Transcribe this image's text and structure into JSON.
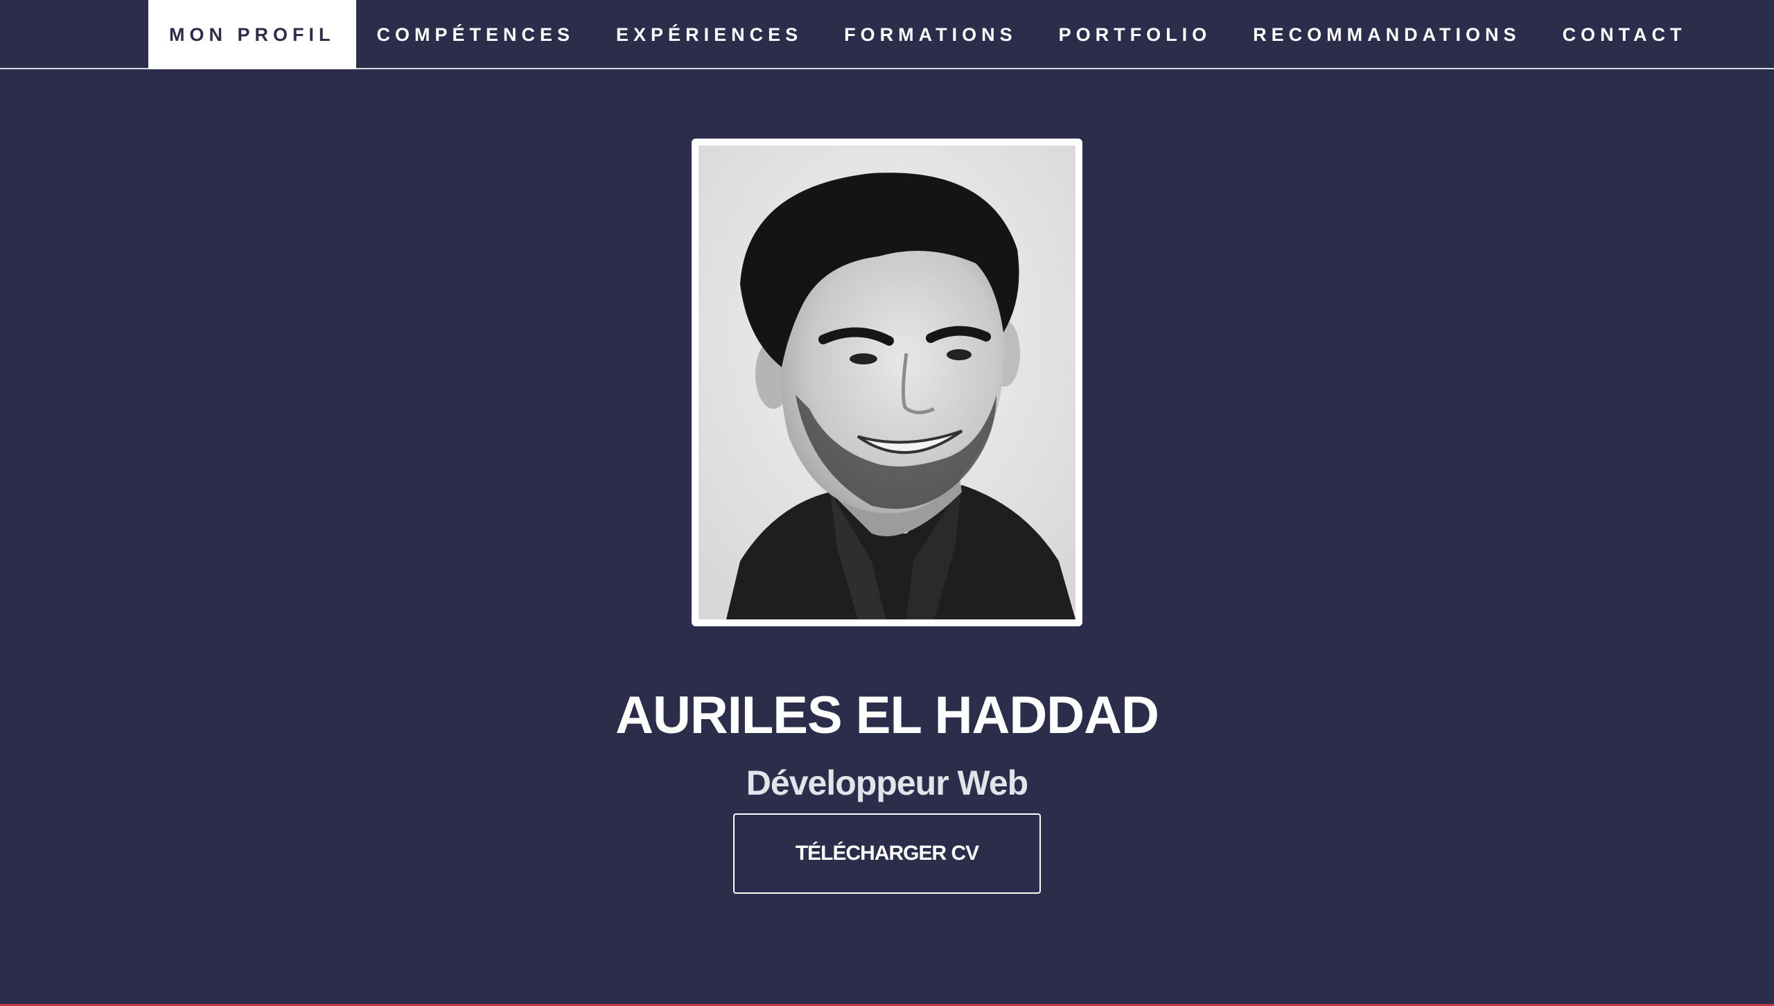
{
  "nav": {
    "items": [
      {
        "label": "MON PROFIL",
        "active": true
      },
      {
        "label": "COMPÉTENCES",
        "active": false
      },
      {
        "label": "EXPÉRIENCES",
        "active": false
      },
      {
        "label": "FORMATIONS",
        "active": false
      },
      {
        "label": "PORTFOLIO",
        "active": false
      },
      {
        "label": "RECOMMANDATIONS",
        "active": false
      },
      {
        "label": "CONTACT",
        "active": false
      }
    ]
  },
  "hero": {
    "photo_icon": "profile-portrait",
    "name": "AURILES EL HADDAD",
    "subtitle": "Développeur Web",
    "cv_button_label": "TÉLÉCHARGER CV"
  },
  "colors": {
    "background": "#2b2d4b",
    "text": "#ffffff",
    "nav_active_bg": "#ffffff",
    "accent_line": "#c0394b"
  }
}
